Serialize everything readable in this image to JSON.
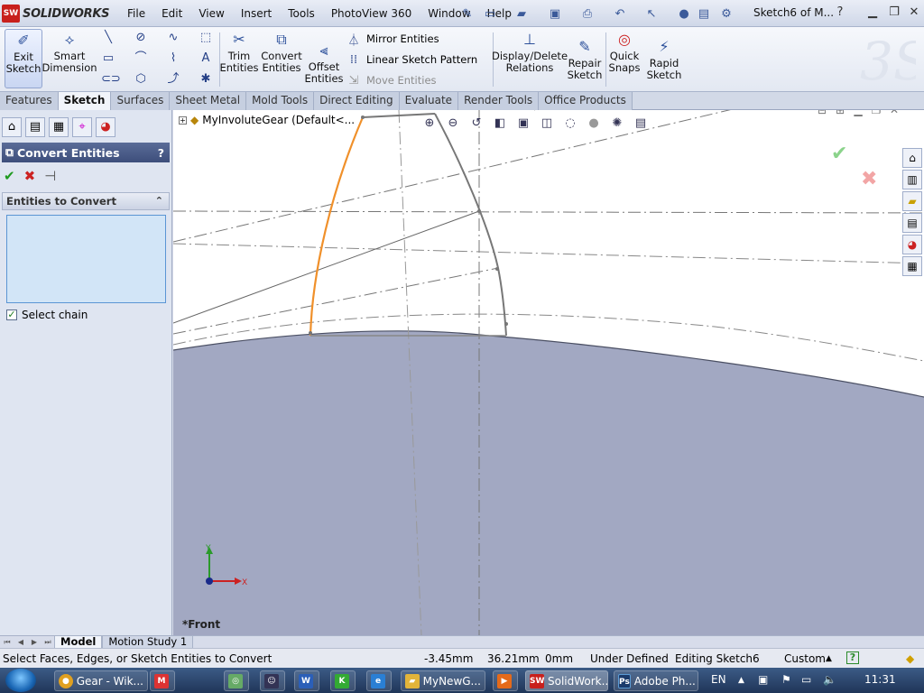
{
  "app": {
    "logo_text": "SOLIDWORKS",
    "logo_mark": "SW",
    "document_title": "Sketch6 of M...",
    "menu": [
      "File",
      "Edit",
      "View",
      "Insert",
      "Tools",
      "PhotoView 360",
      "Window",
      "Help"
    ]
  },
  "ribbon": {
    "exit_sketch": "Exit Sketch",
    "smart_dimension": "Smart Dimension",
    "trim_entities": "Trim Entities",
    "convert_entities": "Convert Entities",
    "offset_entities": "Offset Entities",
    "mirror_entities": "Mirror Entities",
    "linear_sketch_pattern": "Linear Sketch Pattern",
    "move_entities": "Move Entities",
    "display_delete_relations": "Display/Delete Relations",
    "repair_sketch": "Repair Sketch",
    "quick_snaps": "Quick Snaps",
    "rapid_sketch": "Rapid Sketch"
  },
  "tabs": [
    "Features",
    "Sketch",
    "Surfaces",
    "Sheet Metal",
    "Mold Tools",
    "Direct Editing",
    "Evaluate",
    "Render Tools",
    "Office Products"
  ],
  "active_tab": "Sketch",
  "property_manager": {
    "title": "Convert Entities",
    "help": "?",
    "group_title": "Entities to Convert",
    "select_chain_label": "Select chain",
    "select_chain_checked": true
  },
  "viewport": {
    "tree_label": "MyInvoluteGear  (Default<...",
    "view_label": "*Front",
    "axis_y": "Y",
    "axis_x": "X"
  },
  "model_tabs": [
    "Model",
    "Motion Study 1"
  ],
  "status": {
    "message": "Select Faces, Edges, or Sketch Entities to Convert",
    "x": "-3.45mm",
    "y": "36.21mm",
    "z": "0mm",
    "definition": "Under Defined",
    "editing": "Editing Sketch6",
    "units": "Custom",
    "help": "?"
  },
  "taskbar": {
    "items": [
      "Gear - Wik...",
      "MyNewG...",
      "SolidWork...",
      "Adobe Ph..."
    ],
    "lang": "EN",
    "time": "11:31"
  },
  "colors": {
    "accent": "#3d4e7b",
    "selection_field": "#d2e5f7",
    "highlight_curve": "#f0902a",
    "gear_body": "#a2a8c2"
  }
}
